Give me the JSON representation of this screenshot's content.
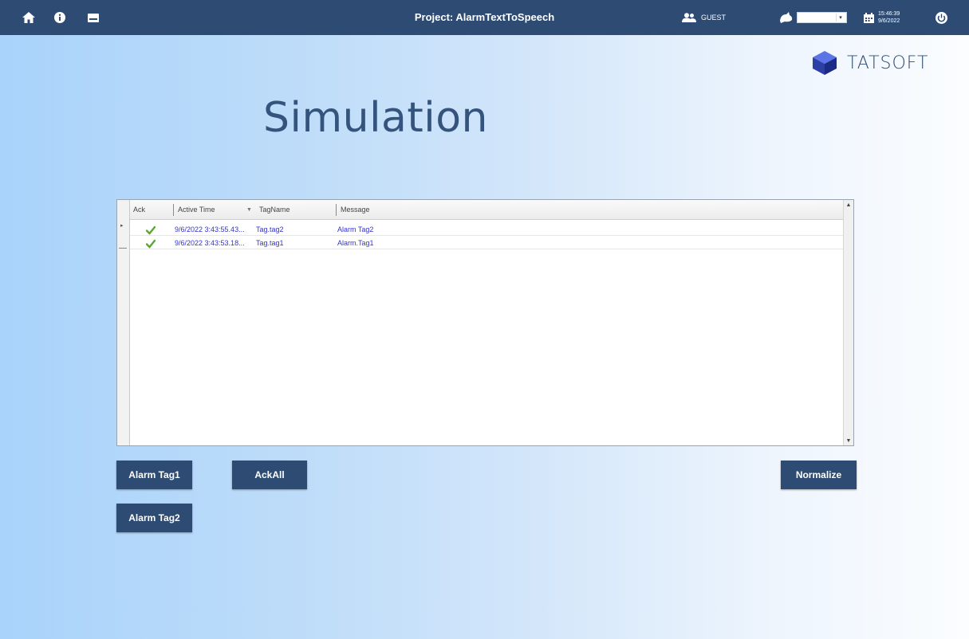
{
  "topbar": {
    "project_title": "Project: AlarmTextToSpeech",
    "user_label": "GUEST",
    "language_value": "",
    "time": "15:46:39",
    "date": "9/6/2022",
    "icons": [
      "home-icon",
      "info-icon",
      "keyboard-icon",
      "users-icon",
      "language-icon",
      "calendar-icon",
      "power-icon"
    ]
  },
  "logo": {
    "text": "TATSOFT"
  },
  "page": {
    "title": "Simulation"
  },
  "alarm_grid": {
    "columns": [
      {
        "label": "Ack"
      },
      {
        "label": "Active Time"
      },
      {
        "label": "TagName"
      },
      {
        "label": "Message"
      }
    ],
    "rows": [
      {
        "ack": true,
        "active_time": "9/6/2022 3:43:55.43...",
        "tag_name": "Tag.tag2",
        "message": "Alarm Tag2"
      },
      {
        "ack": true,
        "active_time": "9/6/2022 3:43:53.18...",
        "tag_name": "Tag.tag1",
        "message": "Alarm.Tag1"
      }
    ]
  },
  "buttons": {
    "alarm_tag1": "Alarm Tag1",
    "ack_all": "AckAll",
    "normalize": "Normalize",
    "alarm_tag2": "Alarm Tag2"
  },
  "colors": {
    "topbar": "#2e4b73",
    "button": "#2e4b73",
    "title": "#34547d",
    "grid_text": "#3333cc",
    "ack_check": "#5aa832"
  }
}
